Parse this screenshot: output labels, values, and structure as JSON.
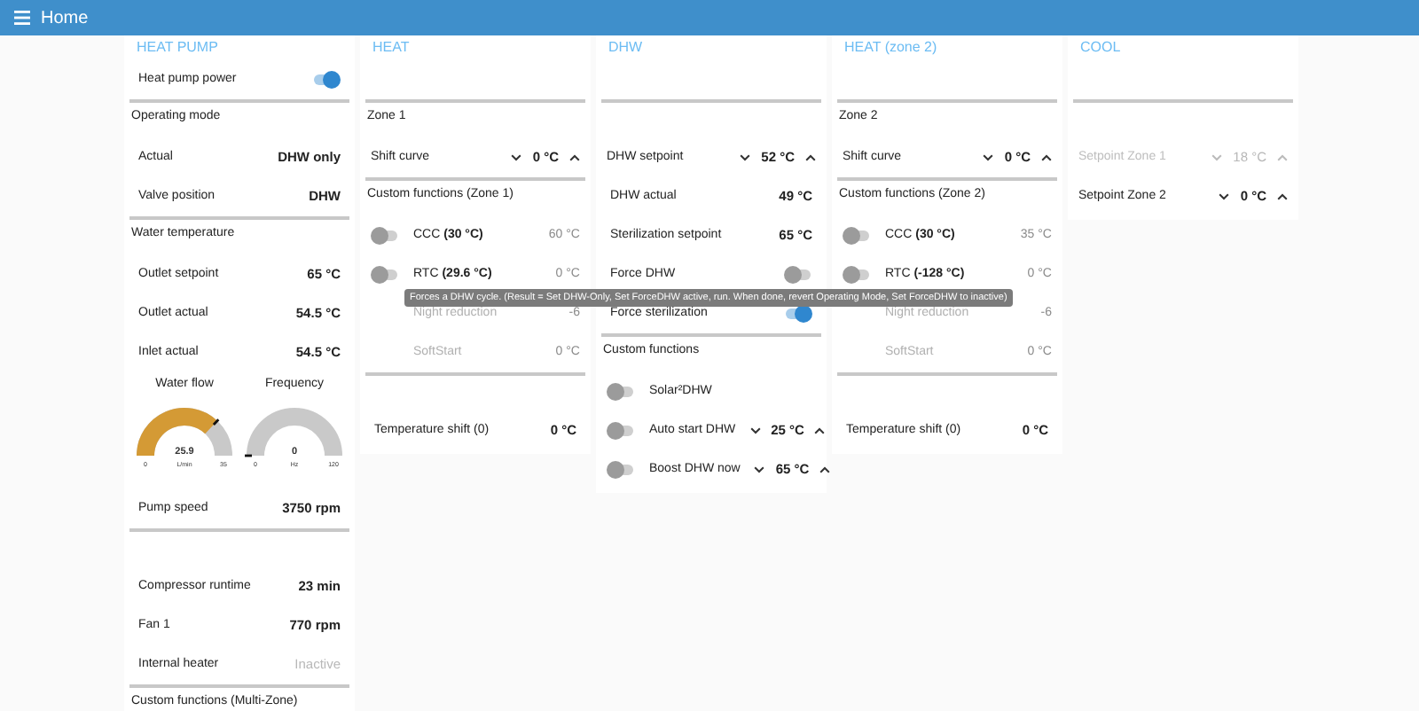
{
  "header": {
    "title": "Home"
  },
  "cards": [
    {
      "title": "HEAT PUMP",
      "rows": [
        {
          "kind": "switch",
          "label": "Heat pump power",
          "on": true
        },
        {
          "kind": "section",
          "title": "Operating mode"
        },
        {
          "kind": "value",
          "label": "Actual",
          "value": "DHW only",
          "disabled": false
        },
        {
          "kind": "value",
          "label": "Valve position",
          "value": "DHW",
          "disabled": false
        },
        {
          "kind": "section",
          "title": "Water temperature"
        },
        {
          "kind": "value",
          "label": "Outlet setpoint",
          "value": "65 °C",
          "disabled": false
        },
        {
          "kind": "value",
          "label": "Outlet actual",
          "value": "54.5 °C",
          "disabled": false
        },
        {
          "kind": "value",
          "label": "Inlet actual",
          "value": "54.5 °C",
          "disabled": false
        },
        {
          "kind": "gauges",
          "gauges": [
            {
              "label": "Water flow",
              "value": "25.9",
              "unit": "L/min",
              "min": "0",
              "max": "35",
              "level": 0.74,
              "color": "#d49a35"
            },
            {
              "label": "Frequency",
              "value": "0",
              "unit": "Hz",
              "min": "0",
              "max": "120",
              "level": 0
            }
          ]
        },
        {
          "kind": "value",
          "label": "Pump speed",
          "value": "3750 rpm",
          "disabled": false
        },
        {
          "kind": "rule"
        },
        {
          "kind": "value",
          "label": "Compressor runtime",
          "value": "23 min",
          "disabled": false
        },
        {
          "kind": "value",
          "label": "Fan 1",
          "value": "770 rpm",
          "disabled": false
        },
        {
          "kind": "value",
          "label": "Internal heater",
          "value": "Inactive",
          "disabled": true
        },
        {
          "kind": "section",
          "title": "Custom functions (Multi-Zone)"
        }
      ]
    },
    {
      "title": "HEAT",
      "rows": [
        {
          "kind": "blank"
        },
        {
          "kind": "section",
          "title": "Zone 1"
        },
        {
          "kind": "stepper",
          "label": "Shift curve",
          "value": "0 °C",
          "disabled": false
        },
        {
          "kind": "section",
          "title": "Custom functions (Zone 1)"
        },
        {
          "kind": "function",
          "label": "CCC **(30 °C)**",
          "value": "60 °C",
          "on": false,
          "disabled": false
        },
        {
          "kind": "function",
          "label": "RTC **(29.6 °C)**",
          "value": "0 °C",
          "on": false,
          "disabled": false
        },
        {
          "kind": "function",
          "label": "Night reduction",
          "value": "-6",
          "disabled": true
        },
        {
          "kind": "function",
          "label": "SoftStart",
          "value": "0 °C",
          "disabled": true
        },
        {
          "kind": "rule"
        },
        {
          "kind": "value",
          "label": "Temperature shift (0)",
          "value": "0 °C",
          "disabled": false
        }
      ]
    },
    {
      "title": "DHW",
      "rows": [
        {
          "kind": "blank"
        },
        {
          "kind": "rule"
        },
        {
          "kind": "stepper",
          "label": "DHW setpoint",
          "value": "52 °C",
          "disabled": false
        },
        {
          "kind": "value",
          "label": "DHW actual",
          "value": "49 °C",
          "disabled": false
        },
        {
          "kind": "value",
          "label": "Sterilization setpoint",
          "value": "65 °C",
          "disabled": false
        },
        {
          "kind": "switch",
          "label": "Force DHW",
          "on": false
        },
        {
          "kind": "switch",
          "label": "Force sterilization",
          "on": true
        },
        {
          "kind": "section",
          "title": "Custom functions"
        },
        {
          "kind": "function",
          "label": "Solar²DHW",
          "on": false,
          "disabled": false
        },
        {
          "kind": "function",
          "label": "Auto start DHW",
          "value": "25 °C",
          "stepper": true,
          "on": false,
          "disabled": false
        },
        {
          "kind": "function",
          "label": "Boost DHW now",
          "value": "65 °C",
          "stepper": true,
          "on": false,
          "disabled": false
        }
      ]
    },
    {
      "title": "HEAT (zone 2)",
      "rows": [
        {
          "kind": "blank"
        },
        {
          "kind": "section",
          "title": "Zone 2"
        },
        {
          "kind": "stepper",
          "label": "Shift curve",
          "value": "0 °C",
          "disabled": false
        },
        {
          "kind": "section",
          "title": "Custom functions (Zone 2)"
        },
        {
          "kind": "function",
          "label": "CCC **(30 °C)**",
          "value": "35 °C",
          "on": false,
          "disabled": false
        },
        {
          "kind": "function",
          "label": "RTC **(-128 °C)**",
          "value": "0 °C",
          "on": false,
          "disabled": false
        },
        {
          "kind": "function",
          "label": "Night reduction",
          "value": "-6",
          "disabled": true
        },
        {
          "kind": "function",
          "label": "SoftStart",
          "value": "0 °C",
          "disabled": true
        },
        {
          "kind": "rule"
        },
        {
          "kind": "value",
          "label": "Temperature shift (0)",
          "value": "0 °C",
          "disabled": false
        }
      ]
    },
    {
      "title": "COOL",
      "rows": [
        {
          "kind": "blank"
        },
        {
          "kind": "rule"
        },
        {
          "kind": "stepper",
          "label": "Setpoint Zone 1",
          "value": "18 °C",
          "disabled": true
        },
        {
          "kind": "stepper",
          "label": "Setpoint Zone 2",
          "value": "0 °C",
          "disabled": false
        }
      ]
    }
  ],
  "tooltip": {
    "text": "Forces a DHW cycle. (Result = Set DHW-Only, Set ForceDHW active, run. When done, revert Operating Mode, Set ForceDHW to inactive)"
  }
}
